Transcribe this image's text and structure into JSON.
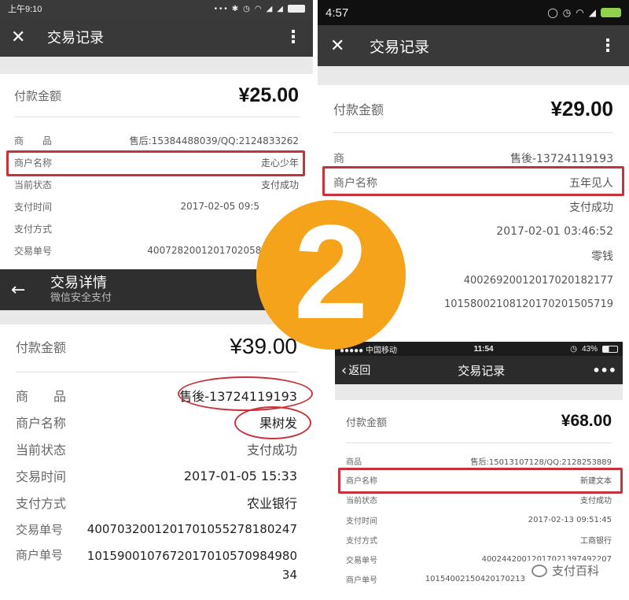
{
  "p1": {
    "status_time": "上午9:10",
    "title": "交易记录",
    "amount_label": "付款金额",
    "amount": "¥25.00",
    "rows": [
      {
        "label": "商　　品",
        "value": "售后:15384488039/QQ:2124833262"
      },
      {
        "label": "商户名称",
        "value": "走心少年"
      },
      {
        "label": "当前状态",
        "value": "支付成功"
      },
      {
        "label": "支付时间",
        "value": "2017-02-05 09:5"
      },
      {
        "label": "支付方式",
        "value": ""
      },
      {
        "label": "交易单号",
        "value": "40072820012017020587"
      }
    ]
  },
  "p2": {
    "status_time": "4:57",
    "title": "交易记录",
    "amount_label": "付款金额",
    "amount": "¥29.00",
    "rows": [
      {
        "label": "商",
        "value": "售後-13724119193"
      },
      {
        "label": "商户名称",
        "value": "五年见人"
      },
      {
        "label": "",
        "value": "支付成功"
      },
      {
        "label": "",
        "value": "2017-02-01 03:46:52"
      },
      {
        "label": "",
        "value": "零钱"
      },
      {
        "label": "",
        "value": "40026920012017020182177"
      },
      {
        "label": "",
        "value": "10158002108120170201505719"
      }
    ]
  },
  "p3": {
    "title": "交易详情",
    "subtitle": "微信安全支付",
    "amount_label": "付款金额",
    "amount": "¥39.00",
    "rows": [
      {
        "label": "商　　品",
        "value": "售後-13724119193"
      },
      {
        "label": "商户名称",
        "value": "果树发"
      },
      {
        "label": "当前状态",
        "value": "支付成功"
      },
      {
        "label": "交易时间",
        "value": "2017-01-05 15:33"
      },
      {
        "label": "支付方式",
        "value": "农业银行"
      },
      {
        "label": "交易单号",
        "value": "4007032001201701055278180247"
      },
      {
        "label": "商户单号",
        "value": "101590010767201701057098498034"
      }
    ]
  },
  "p4": {
    "carrier": "●●●●● 中国移动",
    "status_time": "11:54",
    "battery": "43%",
    "back_label": "返回",
    "title": "交易记录",
    "amount_label": "付款金额",
    "amount": "¥68.00",
    "rows": [
      {
        "label": "商品",
        "value": "售后:15013107128/QQ:2128253889"
      },
      {
        "label": "商户名称",
        "value": "新建文本"
      },
      {
        "label": "当前状态",
        "value": "支付成功"
      },
      {
        "label": "支付时间",
        "value": "2017-02-13 09:51:45"
      },
      {
        "label": "支付方式",
        "value": "工商银行"
      },
      {
        "label": "交易单号",
        "value": "40024420012017021397492207"
      },
      {
        "label": "商户单号",
        "value": "10154002150420170213"
      }
    ]
  },
  "badge_number": "2",
  "watermark": "支付百科",
  "colors": {
    "orange": "#f5a31a",
    "red": "#c8333b",
    "dark_bar": "#2f2f2f"
  }
}
